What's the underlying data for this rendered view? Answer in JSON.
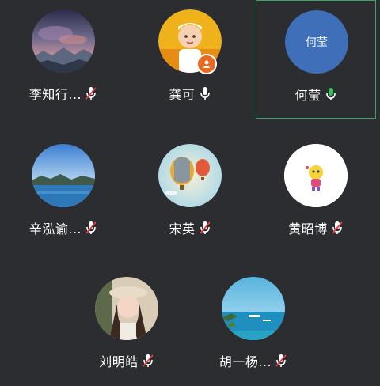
{
  "participants": [
    {
      "name": "李知行...",
      "mic": "muted",
      "avatar": "photo-night-sky"
    },
    {
      "name": "龚可",
      "mic": "on",
      "avatar": "photo-child",
      "host_badge": "person-icon"
    },
    {
      "name": "何莹",
      "mic": "speaking",
      "avatar": "initials",
      "avatar_text": "何莹",
      "avatar_color": "#3e6fb8",
      "active": true
    },
    {
      "name": "辛泓谕...",
      "mic": "muted",
      "avatar": "photo-lake"
    },
    {
      "name": "宋英",
      "mic": "muted",
      "avatar": "photo-balloons"
    },
    {
      "name": "黄昭博",
      "mic": "muted",
      "avatar": "photo-cartoon"
    },
    {
      "name": "刘明皓",
      "mic": "muted",
      "avatar": "photo-woman-hat"
    },
    {
      "name": "胡一杨...",
      "mic": "muted",
      "avatar": "photo-sea"
    }
  ],
  "colors": {
    "background": "#2b2d30",
    "active_border": "#3aa564",
    "mic_on": "#ffffff",
    "mic_speaking": "#36c15a",
    "mic_muted_slash": "#e23b3b"
  }
}
